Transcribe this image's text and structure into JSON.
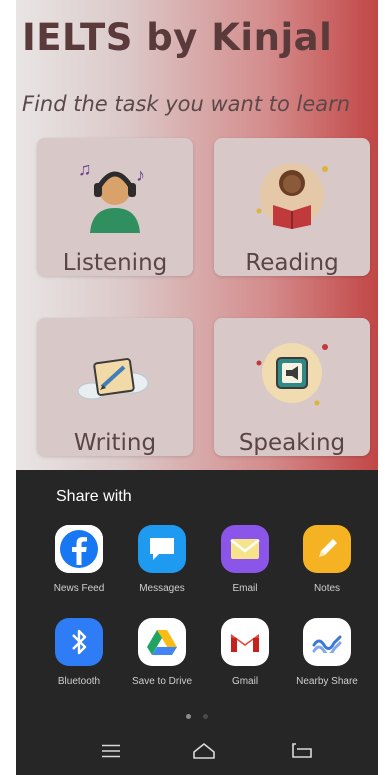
{
  "app": {
    "title": "IELTS by Kinjal",
    "subtitle": "Find the task you want to learn",
    "cards": [
      {
        "label": "Listening",
        "icon": "headphones-person-icon"
      },
      {
        "label": "Reading",
        "icon": "reading-person-icon"
      },
      {
        "label": "Writing",
        "icon": "pencil-board-icon"
      },
      {
        "label": "Speaking",
        "icon": "megaphone-icon"
      }
    ]
  },
  "share_sheet": {
    "title": "Share with",
    "apps": [
      {
        "label": "News Feed",
        "icon": "facebook-icon",
        "color": "#1877F2"
      },
      {
        "label": "Messages",
        "icon": "message-bubble-icon",
        "color": "#1E9BF0"
      },
      {
        "label": "Email",
        "icon": "envelope-icon",
        "color": "#8A55E8"
      },
      {
        "label": "Notes",
        "icon": "pencil-icon",
        "color": "#F5B323"
      },
      {
        "label": "Bluetooth",
        "icon": "bluetooth-icon",
        "color": "#2E7CF6"
      },
      {
        "label": "Save to Drive",
        "icon": "google-drive-icon",
        "color": "#FFFFFF"
      },
      {
        "label": "Gmail",
        "icon": "gmail-icon",
        "color": "#FFFFFF"
      },
      {
        "label": "Nearby Share",
        "icon": "nearby-share-icon",
        "color": "#FFFFFF"
      }
    ],
    "page_indicator": {
      "pages": 2,
      "current": 1
    }
  },
  "navbar": {
    "buttons": [
      "menu-icon",
      "home-icon",
      "back-icon"
    ]
  }
}
